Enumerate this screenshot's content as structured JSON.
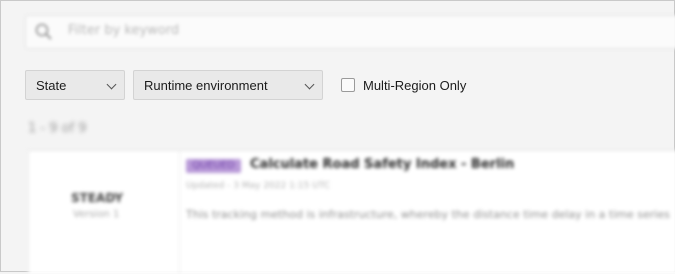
{
  "search": {
    "placeholder": "Filter by keyword"
  },
  "filters": {
    "state_label": "State",
    "runtime_label": "Runtime environment",
    "multi_region_label": "Multi-Region Only",
    "multi_region_checked": false
  },
  "section": {
    "heading": "1 - 9 of 9"
  },
  "result": {
    "left_main": "STEADY",
    "left_sub": "Version 1",
    "badge": "QUEUED",
    "title": "Calculate Road Safety Index - Berlin",
    "meta": "Updated - 3 May 2022 1:15 UTC",
    "description": "This tracking method is infrastructure, whereby the distance time delay in a time series"
  },
  "colors": {
    "badge_bg": "#b99ad8",
    "badge_text": "#6d3fa8",
    "background": "#f4f4f4"
  }
}
